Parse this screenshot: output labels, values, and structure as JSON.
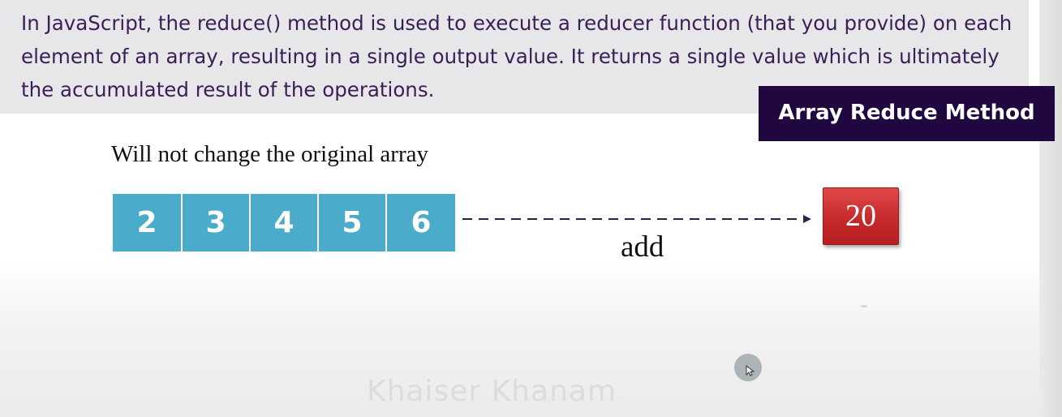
{
  "description": {
    "text": "In JavaScript, the reduce() method is used to execute a reducer function (that you provide) on each element of an array, resulting in a single output value. It returns a single value which is ultimately the accumulated result of the operations."
  },
  "title": "Array Reduce Method",
  "subtitle": "Will not change the original array",
  "array": {
    "values": [
      "2",
      "3",
      "4",
      "5",
      "6"
    ]
  },
  "operation": {
    "label": "add"
  },
  "result": {
    "value": "20"
  },
  "watermark": "Khaiser Khanam",
  "colors": {
    "description_bg": "#e7e7ea",
    "description_text": "#3a1f57",
    "title_bg": "#21073f",
    "array_cell": "#4aabcb",
    "result_box": "#c62a2b",
    "arrow": "#1f2a4a"
  },
  "icons": {
    "cursor": "pointer-cursor-icon",
    "arrow": "dashed-arrow-right-icon"
  }
}
